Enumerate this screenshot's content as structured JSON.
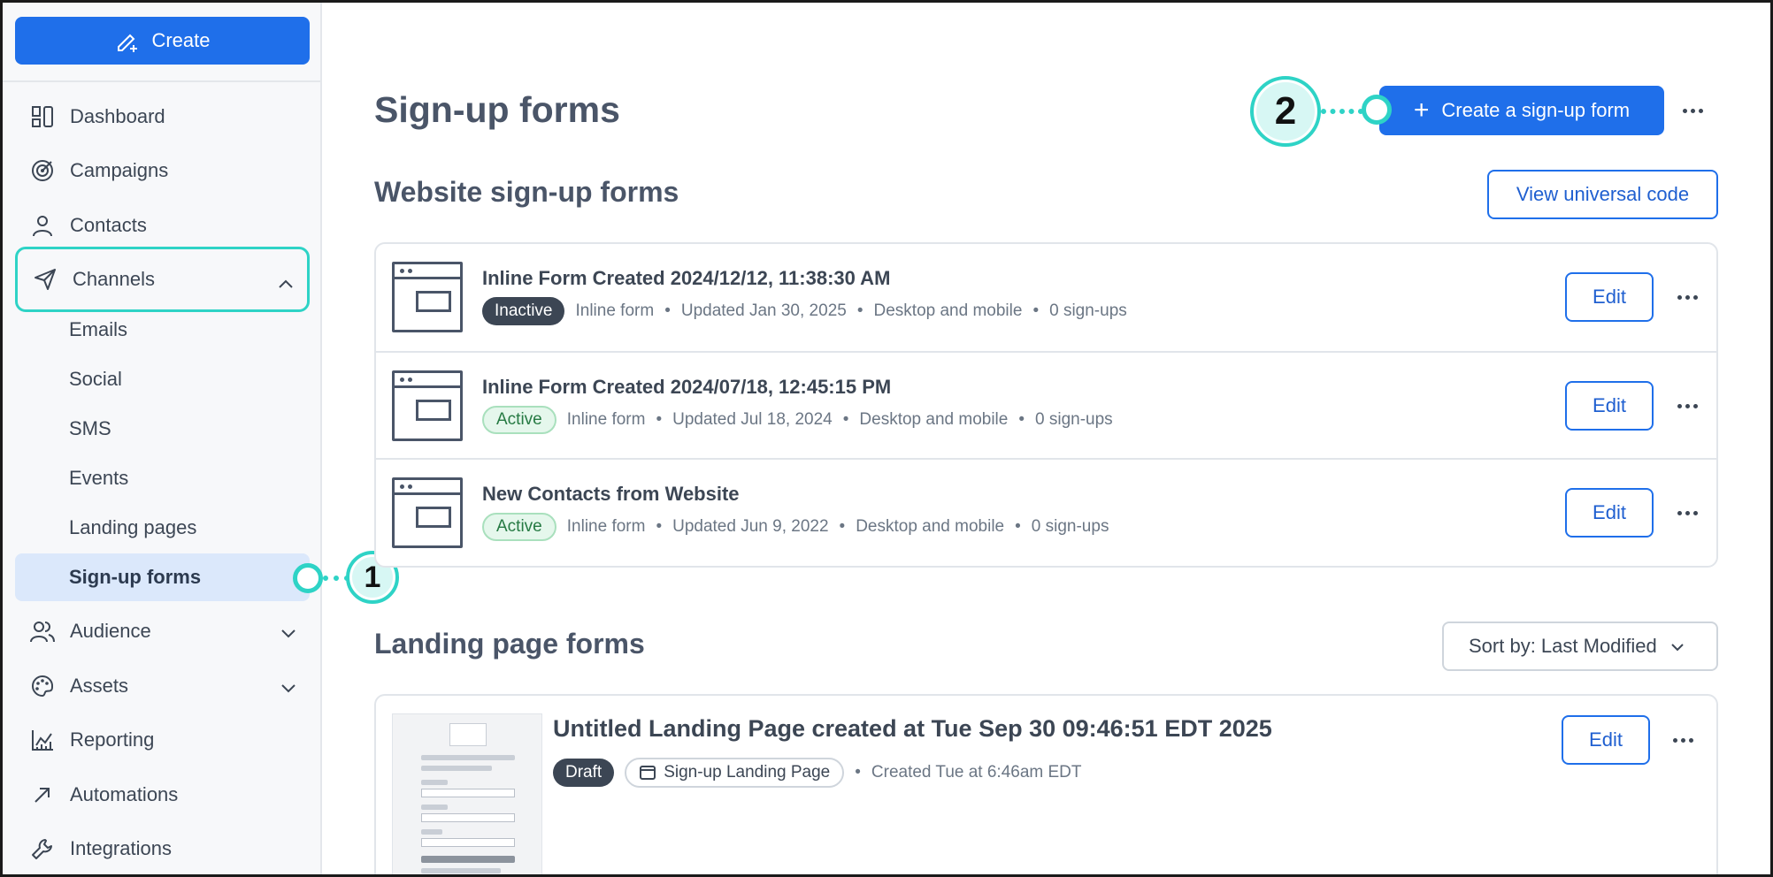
{
  "sidebar": {
    "create_label": "Create",
    "items": [
      {
        "label": "Dashboard",
        "icon": "dashboard-icon"
      },
      {
        "label": "Campaigns",
        "icon": "target-icon"
      },
      {
        "label": "Contacts",
        "icon": "person-icon"
      },
      {
        "label": "Channels",
        "icon": "send-icon"
      },
      {
        "label": "Audience",
        "icon": "people-icon"
      },
      {
        "label": "Assets",
        "icon": "palette-icon"
      },
      {
        "label": "Reporting",
        "icon": "chart-icon"
      },
      {
        "label": "Automations",
        "icon": "arrow-up-right-icon"
      },
      {
        "label": "Integrations",
        "icon": "wrench-icon"
      }
    ],
    "channel_items": [
      "Emails",
      "Social",
      "SMS",
      "Events",
      "Landing pages",
      "Sign-up forms"
    ]
  },
  "callouts": {
    "one": "1",
    "two": "2"
  },
  "page": {
    "title": "Sign-up forms",
    "create_form_label": "Create a sign-up form"
  },
  "website_forms": {
    "title": "Website sign-up forms",
    "universal_code_label": "View universal code",
    "edit_label": "Edit",
    "rows": [
      {
        "title": "Inline Form Created 2024/12/12, 11:38:30 AM",
        "status": "Inactive",
        "type": "Inline form",
        "updated": "Updated Jan 30, 2025",
        "devices": "Desktop and mobile",
        "signups": "0 sign-ups"
      },
      {
        "title": "Inline Form Created 2024/07/18, 12:45:15 PM",
        "status": "Active",
        "type": "Inline form",
        "updated": "Updated Jul 18, 2024",
        "devices": "Desktop and mobile",
        "signups": "0 sign-ups"
      },
      {
        "title": "New Contacts from Website",
        "status": "Active",
        "type": "Inline form",
        "updated": "Updated Jun 9, 2022",
        "devices": "Desktop and mobile",
        "signups": "0 sign-ups"
      }
    ]
  },
  "landing_forms": {
    "title": "Landing page forms",
    "sort_label": "Sort by: Last Modified",
    "edit_label": "Edit",
    "item": {
      "title": "Untitled Landing Page created at Tue Sep 30 09:46:51 EDT 2025",
      "status": "Draft",
      "type": "Sign-up Landing Page",
      "created": "Created Tue at 6:46am EDT"
    }
  },
  "colors": {
    "primary": "#1f6fea",
    "callout": "#2ed3c6",
    "active_bg": "#dbe8fb"
  }
}
